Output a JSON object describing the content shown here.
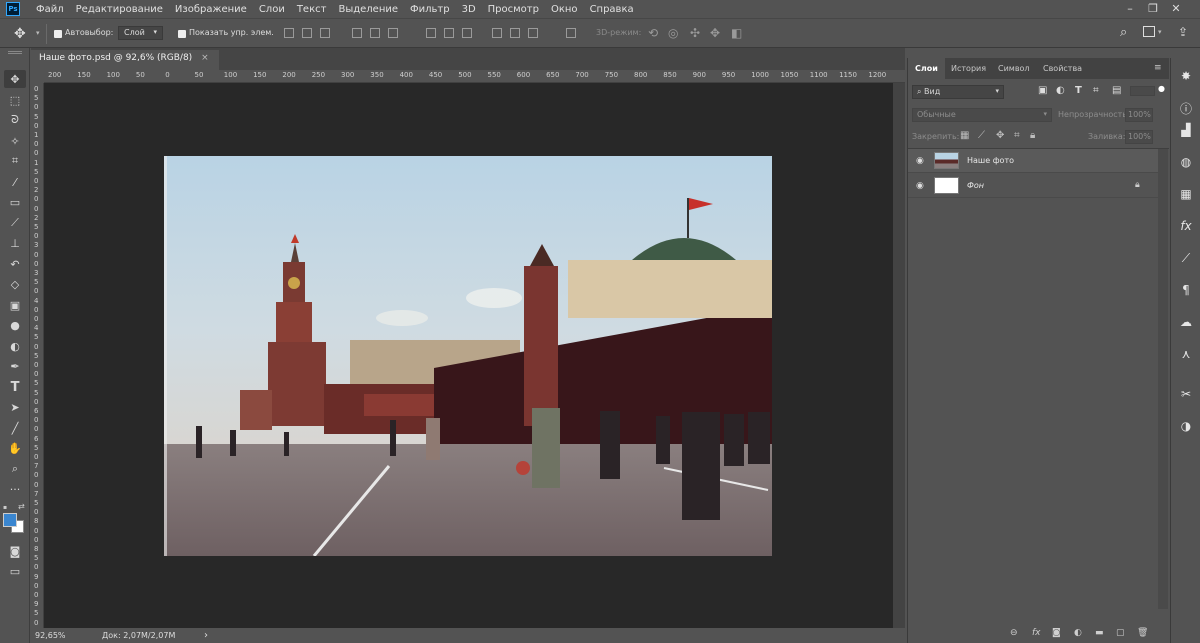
{
  "app": {
    "logo": "Ps"
  },
  "menu": [
    "Файл",
    "Редактирование",
    "Изображение",
    "Слои",
    "Текст",
    "Выделение",
    "Фильтр",
    "3D",
    "Просмотр",
    "Окно",
    "Справка"
  ],
  "window_controls": {
    "minimize": "–",
    "restore": "❐",
    "close": "✕"
  },
  "options_bar": {
    "autoselect_label": "Автовыбор:",
    "autoselect_value": "Слой",
    "show_controls_label": "Показать упр. элем.",
    "mode3d_label": "3D-режим:"
  },
  "document": {
    "tab_title": "Наше фото.psd @ 92,6% (RGB/8)",
    "close_symbol": "×"
  },
  "rulers": {
    "horizontal": [
      "200",
      "150",
      "100",
      "50",
      "0",
      "50",
      "100",
      "150",
      "200",
      "250",
      "300",
      "350",
      "400",
      "450",
      "500",
      "550",
      "600",
      "650",
      "700",
      "750",
      "800",
      "850",
      "900",
      "950",
      "1000",
      "1050",
      "1100",
      "1150",
      "1200"
    ],
    "vertical": [
      "0",
      "5",
      "0",
      "5",
      "0",
      "1",
      "0",
      "0",
      "1",
      "5",
      "0",
      "2",
      "0",
      "0",
      "2",
      "5",
      "0",
      "3",
      "0",
      "0",
      "3",
      "5",
      "0",
      "4",
      "0",
      "0",
      "4",
      "5",
      "0",
      "5",
      "0",
      "0",
      "5",
      "5",
      "0",
      "6",
      "0",
      "0",
      "6",
      "5",
      "0",
      "7",
      "0",
      "0",
      "7",
      "5",
      "0",
      "8",
      "0",
      "0",
      "8",
      "5",
      "0",
      "9",
      "0",
      "0",
      "9",
      "5",
      "0"
    ]
  },
  "status": {
    "zoom": "92,65%",
    "doc_info": "Док: 2,07M/2,07M",
    "arrow": "›"
  },
  "panel": {
    "tabs": [
      "Слои",
      "История",
      "Символ",
      "Свойства"
    ],
    "filter_label": "Вид",
    "blend_mode": "Обычные",
    "opacity_label": "Непрозрачность:",
    "opacity_value": "100%",
    "lock_label": "Закрепить:",
    "fill_label": "Заливка:",
    "fill_value": "100%",
    "layers": [
      {
        "name": "Наше фото",
        "visible": true,
        "locked": false
      },
      {
        "name": "Фон",
        "visible": true,
        "locked": true
      }
    ]
  },
  "colors": {
    "foreground": "#3a86d0",
    "background": "#ffffff",
    "canvas_bg": "#282828",
    "ui_bg": "#535353"
  },
  "icons": [
    "move-tool-icon",
    "marquee-icon",
    "lasso-icon",
    "magic-wand-icon",
    "crop-icon",
    "eyedropper-icon",
    "healing-brush-icon",
    "brush-icon",
    "clone-stamp-icon",
    "history-brush-icon",
    "eraser-icon",
    "gradient-icon",
    "blur-icon",
    "dodge-icon",
    "pen-icon",
    "type-icon",
    "path-selection-icon",
    "line-icon",
    "hand-icon",
    "zoom-icon",
    "more-tools-icon"
  ]
}
